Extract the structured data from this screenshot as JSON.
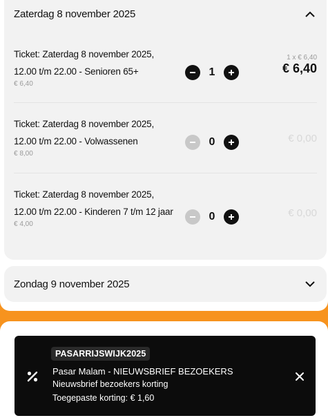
{
  "days": [
    {
      "title": "Zaterdag 8 november 2025",
      "expanded": true,
      "tickets": [
        {
          "name": "Ticket: Zaterdag 8 november 2025, 12.00 t/m 22.00 - Senioren 65+",
          "price": "€ 6,40",
          "quantity": "1",
          "unit_line": "1 x € 6,40",
          "total": "€ 6,40"
        },
        {
          "name": "Ticket: Zaterdag 8 november 2025, 12.00 t/m 22.00 - Volwassenen",
          "price": "€ 8,00",
          "quantity": "0",
          "total": "€ 0,00"
        },
        {
          "name": "Ticket: Zaterdag 8 november 2025, 12.00 t/m 22.00 - Kinderen 7 t/m 12 jaar",
          "price": "€ 4,00",
          "quantity": "0",
          "total": "€ 0,00"
        }
      ]
    },
    {
      "title": "Zondag 9 november 2025",
      "expanded": false
    }
  ],
  "discount": {
    "code": "PASARRIJSWIJK2025",
    "title": "Pasar Malam - NIEUWSBRIEF BEZOEKERS",
    "description": "Nieuwsbrief bezoekers korting",
    "applied": "Toegepaste korting: € 1,60"
  },
  "colors": {
    "accent": "#f7931e",
    "card": "#f2f2f2",
    "dark": "#111111"
  }
}
